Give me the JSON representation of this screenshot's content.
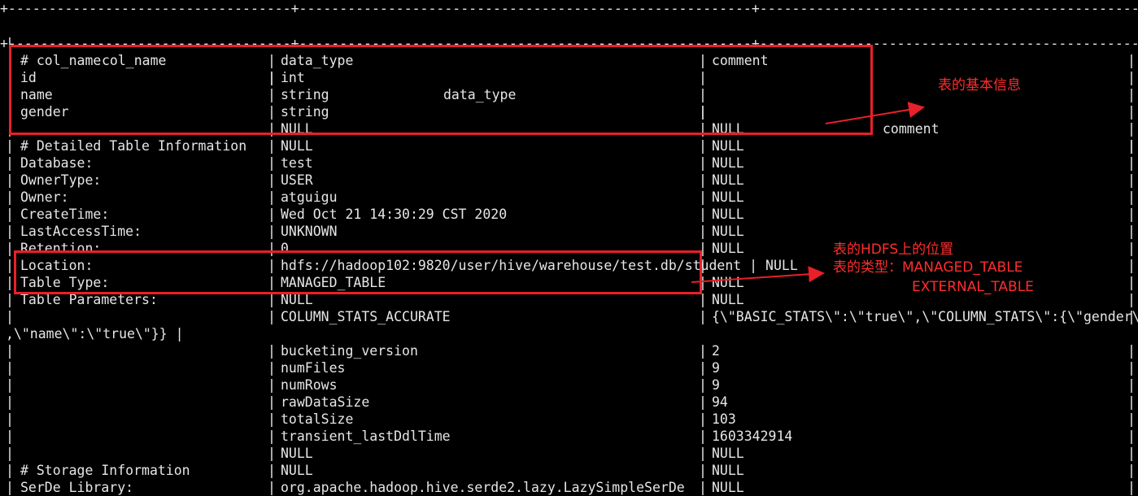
{
  "terminal": {
    "rule_line": "+-----------------------------------+--------------------------------------------------------+---------------------------------------------------+",
    "header": {
      "col_name": "col_name",
      "data_type": "data_type",
      "comment": "comment"
    },
    "rows": [
      {
        "a": "# col_name",
        "b": "data_type",
        "c": "comment"
      },
      {
        "a": "id",
        "b": "int",
        "c": ""
      },
      {
        "a": "name",
        "b": "string",
        "c": ""
      },
      {
        "a": "gender",
        "b": "string",
        "c": ""
      },
      {
        "a": "",
        "b": "NULL",
        "c": "NULL"
      },
      {
        "a": "# Detailed Table Information",
        "b": "NULL",
        "c": "NULL"
      },
      {
        "a": "Database:",
        "b": "test",
        "c": "NULL"
      },
      {
        "a": "OwnerType:",
        "b": "USER",
        "c": "NULL"
      },
      {
        "a": "Owner:",
        "b": "atguigu",
        "c": "NULL"
      },
      {
        "a": "CreateTime:",
        "b": "Wed Oct 21 14:30:29 CST 2020",
        "c": "NULL"
      },
      {
        "a": "LastAccessTime:",
        "b": "UNKNOWN",
        "c": "NULL"
      },
      {
        "a": "Retention:",
        "b": "0",
        "c": "NULL"
      },
      {
        "a": "Location:",
        "b": "hdfs://hadoop102:9820/user/hive/warehouse/test.db/student | NULL",
        "c": ""
      },
      {
        "a": "Table Type:",
        "b": "MANAGED_TABLE",
        "c": "NULL"
      },
      {
        "a": "Table Parameters:",
        "b": "NULL",
        "c": "NULL"
      },
      {
        "a": "",
        "b": "COLUMN_STATS_ACCURATE",
        "c": "{\\\"BASIC_STATS\\\":\\\"true\\\",\\\"COLUMN_STATS\\\":{\\\"gender\\\""
      },
      {
        "wrap": ",\\\"name\\\":\\\"true\\\"}} |"
      },
      {
        "a": "",
        "b": "bucketing_version",
        "c": "2"
      },
      {
        "a": "",
        "b": "numFiles",
        "c": "9"
      },
      {
        "a": "",
        "b": "numRows",
        "c": "9"
      },
      {
        "a": "",
        "b": "rawDataSize",
        "c": "94"
      },
      {
        "a": "",
        "b": "totalSize",
        "c": "103"
      },
      {
        "a": "",
        "b": "transient_lastDdlTime",
        "c": "1603342914"
      },
      {
        "a": "",
        "b": "NULL",
        "c": "NULL"
      },
      {
        "a": "# Storage Information",
        "b": "NULL",
        "c": "NULL"
      },
      {
        "a": "SerDe Library:",
        "b": "org.apache.hadoop.hive.serde2.lazy.LazySimpleSerDe",
        "c": "NULL"
      }
    ]
  },
  "annotations": {
    "basic_info": "表的基本信息",
    "hdfs_location": "表的HDFS上的位置",
    "table_type": "表的类型：MANAGED_TABLE",
    "table_type_external": "EXTERNAL_TABLE"
  },
  "colors": {
    "background": "#000000",
    "text": "#e6e6e6",
    "annotation": "#e8202a"
  }
}
